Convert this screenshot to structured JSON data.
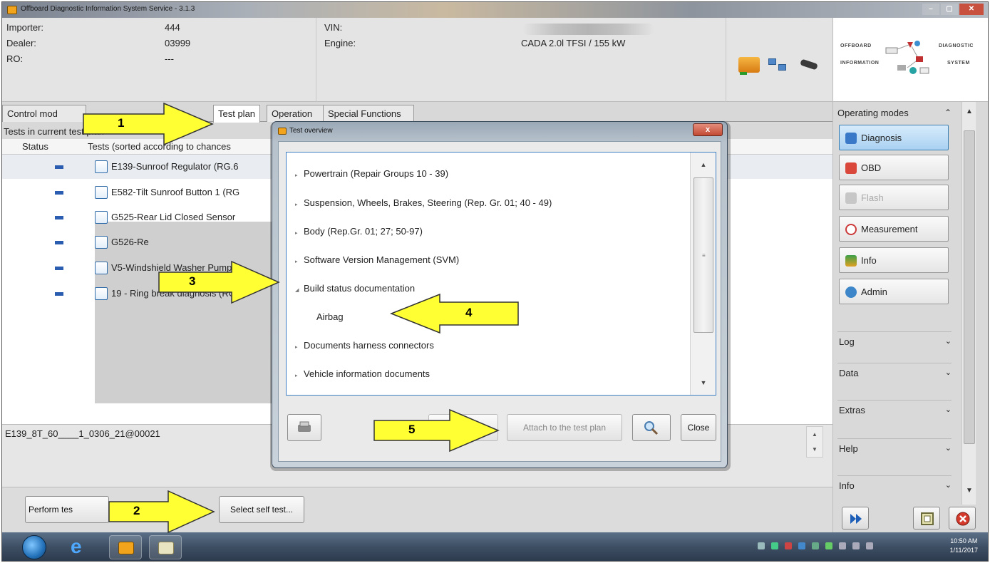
{
  "window": {
    "title": "Offboard Diagnostic Information System Service - 3.1.3"
  },
  "header": {
    "importer_label": "Importer:",
    "importer_value": "444",
    "dealer_label": "Dealer:",
    "dealer_value": "03999",
    "ro_label": "RO:",
    "ro_value": "---",
    "vin_label": "VIN:",
    "engine_label": "Engine:",
    "engine_value": "CADA 2.0l TFSI / 155 kW"
  },
  "logo": {
    "w1": "OFFBOARD",
    "w2": "DIAGNOSTIC",
    "w3": "INFORMATION",
    "w4": "SYSTEM"
  },
  "tabs": [
    {
      "label": "Control mod"
    },
    {
      "label": "Test plan"
    },
    {
      "label": "Operation"
    },
    {
      "label": "Special Functions"
    }
  ],
  "test_plan": {
    "caption": "Tests in current test plan",
    "col_status": "Status",
    "col_tests": "Tests (sorted according to chances",
    "rows": [
      {
        "name": "E139-Sunroof Regulator (RG.6"
      },
      {
        "name": "E582-Tilt Sunroof Button 1 (RG"
      },
      {
        "name": "G525-Rear Lid Closed Sensor"
      },
      {
        "name": "G526-Re"
      },
      {
        "name": "V5-Windshield Washer Pump (I"
      },
      {
        "name": "19 - Ring break diagnosis (RG.9"
      }
    ],
    "selected_id": "E139_8T_60____1_0306_21@00021"
  },
  "bottom_bar": {
    "perform_label": "Perform tes",
    "select_self_label": "Select self test..."
  },
  "dialog": {
    "title": "Test overview",
    "close_x": "x",
    "items": [
      {
        "label": "Powertrain (Repair Groups 10 - 39)",
        "tri": "▸"
      },
      {
        "label": "Suspension, Wheels, Brakes, Steering (Rep. Gr. 01; 40 - 49)",
        "tri": "▸"
      },
      {
        "label": "Body (Rep.Gr. 01; 27; 50-97)",
        "tri": "▸"
      },
      {
        "label": "Software Version Management (SVM)",
        "tri": "▸"
      },
      {
        "label": "Build status documentation",
        "tri": "◢"
      },
      {
        "label": "Documents harness connectors",
        "tri": "▸"
      },
      {
        "label": "Vehicle information documents",
        "tri": "▸"
      }
    ],
    "child_item": "Airbag",
    "attach_label": "Attach to the test plan",
    "close_label": "Close"
  },
  "sidebar": {
    "heading": "Operating modes",
    "heading_chev": "⌃",
    "buttons": [
      {
        "label": "Diagnosis",
        "color": "#3a78c8"
      },
      {
        "label": "OBD",
        "color": "#d9483b"
      },
      {
        "label": "Flash",
        "color": "#bbbbbb"
      },
      {
        "label": "Measurement",
        "color": "#cc3a3a"
      },
      {
        "label": "Info",
        "color": "#e0a020"
      },
      {
        "label": "Admin",
        "color": "#3c86c9"
      }
    ],
    "sections": [
      {
        "label": "Log"
      },
      {
        "label": "Data"
      },
      {
        "label": "Extras"
      },
      {
        "label": "Help"
      },
      {
        "label": "Info"
      }
    ],
    "sec_chev": "⌄"
  },
  "taskbar": {
    "time": "10:50 AM",
    "date": "1/11/2017"
  },
  "callouts": {
    "n1": "1",
    "n2": "2",
    "n3": "3",
    "n4": "4",
    "n5": "5"
  },
  "colors": {
    "arrow_fill": "#ffff33",
    "active_blue": "#a9d1f2",
    "dialog_border": "#3e7fc4"
  }
}
